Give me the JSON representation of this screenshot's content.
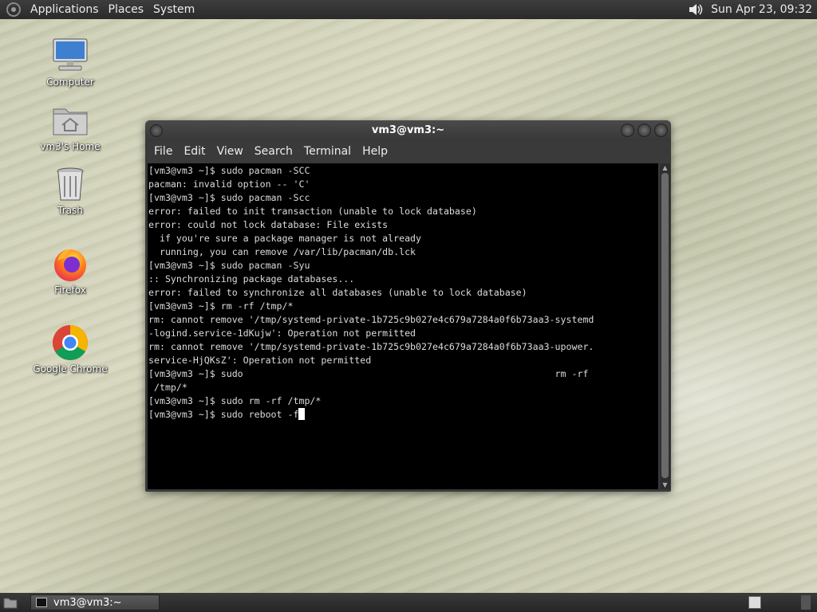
{
  "top_panel": {
    "menus": [
      "Applications",
      "Places",
      "System"
    ],
    "clock": "Sun Apr 23, 09:32"
  },
  "desktop_icons": [
    {
      "label": "Computer",
      "icon": "computer-icon"
    },
    {
      "label": "vm3's Home",
      "icon": "home-folder-icon"
    },
    {
      "label": "Trash",
      "icon": "trash-icon"
    },
    {
      "label": "Firefox",
      "icon": "firefox-icon"
    },
    {
      "label": "Google Chrome",
      "icon": "chrome-icon"
    }
  ],
  "terminal": {
    "title": "vm3@vm3:~",
    "menus": [
      "File",
      "Edit",
      "View",
      "Search",
      "Terminal",
      "Help"
    ],
    "lines": [
      "[vm3@vm3 ~]$ sudo pacman -SCC",
      "pacman: invalid option -- 'C'",
      "[vm3@vm3 ~]$ sudo pacman -Scc",
      "error: failed to init transaction (unable to lock database)",
      "error: could not lock database: File exists",
      "  if you're sure a package manager is not already",
      "  running, you can remove /var/lib/pacman/db.lck",
      "[vm3@vm3 ~]$ sudo pacman -Syu",
      ":: Synchronizing package databases...",
      "error: failed to synchronize all databases (unable to lock database)",
      "[vm3@vm3 ~]$ rm -rf /tmp/*",
      "rm: cannot remove '/tmp/systemd-private-1b725c9b027e4c679a7284a0f6b73aa3-systemd",
      "-logind.service-1dKujw': Operation not permitted",
      "rm: cannot remove '/tmp/systemd-private-1b725c9b027e4c679a7284a0f6b73aa3-upower.",
      "service-HjQKsZ': Operation not permitted",
      "[vm3@vm3 ~]$ sudo                                                        rm -rf",
      " /tmp/*",
      "[vm3@vm3 ~]$ sudo rm -rf /tmp/*"
    ],
    "current_input": "[vm3@vm3 ~]$ sudo reboot -f"
  },
  "bottom_panel": {
    "task_label": "vm3@vm3:~"
  }
}
